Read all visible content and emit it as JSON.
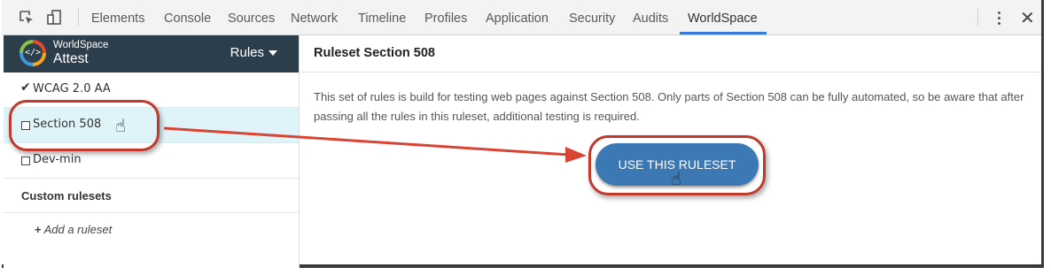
{
  "devtools": {
    "tabs": [
      "Elements",
      "Console",
      "Sources",
      "Network",
      "Timeline",
      "Profiles",
      "Application",
      "Security",
      "Audits",
      "WorldSpace"
    ],
    "active_tab": "WorldSpace",
    "accent_color": "#3879d9"
  },
  "sidebar": {
    "brand_top": "WorldSpace",
    "brand_bottom": "Attest",
    "brand_bg": "#2c3e4c",
    "rules_menu_label": "Rules",
    "rulesets": [
      {
        "label": "WCAG 2.0 AA",
        "state": "checked"
      },
      {
        "label": "Section 508",
        "state": "selected"
      },
      {
        "label": "Dev-min",
        "state": "unchecked"
      }
    ],
    "custom_heading": "Custom rulesets",
    "add_ruleset_label": "Add a ruleset"
  },
  "main": {
    "title": "Ruleset Section 508",
    "description": "This set of rules is build for testing web pages against Section 508. Only parts of Section 508 can be fully automated, so be aware that after passing all the rules in this ruleset, additional testing is required.",
    "use_button_label": "USE THIS RULESET",
    "button_color": "#3b78b4"
  },
  "annotations": {
    "callout_color": "#c0392b"
  }
}
